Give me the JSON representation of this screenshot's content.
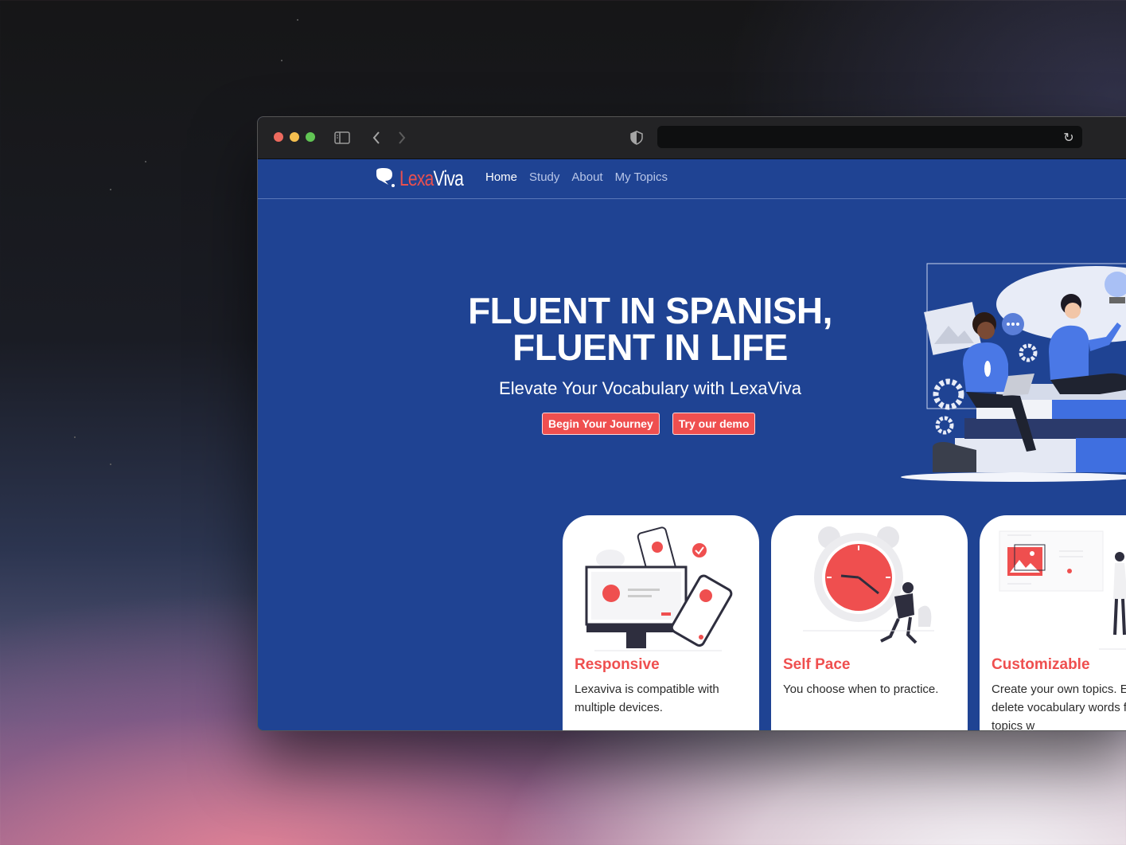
{
  "browser": {
    "traffic_lights": {
      "close": "#ed6a5e",
      "minimize": "#f5bf4f",
      "maximize": "#61c554"
    },
    "sidebar_icon": "sidebar-toggle-icon",
    "back_icon": "chevron-left-icon",
    "forward_icon": "chevron-right-icon",
    "shield_icon": "shield-icon",
    "address": "",
    "reload_glyph": "↻"
  },
  "site": {
    "logo": {
      "part1": "Lexa",
      "part2": "Viva",
      "icon": "speech-bubble-icon"
    },
    "nav": [
      {
        "label": "Home",
        "active": true
      },
      {
        "label": "Study",
        "active": false
      },
      {
        "label": "About",
        "active": false
      },
      {
        "label": "My Topics",
        "active": false
      }
    ],
    "hero": {
      "title_line1": "FLUENT IN SPANISH,",
      "title_line2": "FLUENT IN LIFE",
      "subtitle": "Elevate Your Vocabulary with LexaViva",
      "primary_button": "Begin Your Journey",
      "secondary_button": "Try our demo"
    },
    "features": [
      {
        "title": "Responsive",
        "text": "Lexaviva is compatible with multiple devices."
      },
      {
        "title": "Self Pace",
        "text": "You choose when to practice."
      },
      {
        "title": "Customizable",
        "text": "Create your own topics. Edit, add, and delete vocabulary words from your topics w"
      }
    ]
  },
  "colors": {
    "brand_blue": "#1f4393",
    "accent_red": "#ef4f4f"
  }
}
